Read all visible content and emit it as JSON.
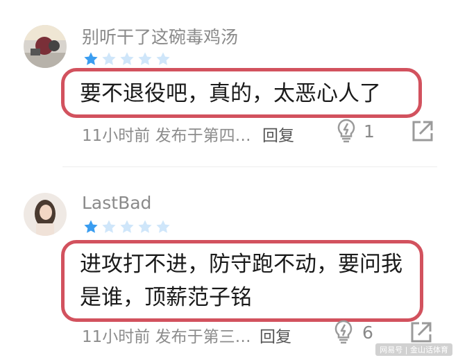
{
  "comments": [
    {
      "username": "别听干了这碗毒鸡汤",
      "rating": 1,
      "max_rating": 5,
      "text_lines": [
        "要不退役吧，真的，太恶心人了"
      ],
      "time": "11小时前",
      "published": "发布于第四…",
      "reply_label": "回复",
      "like_count": "1"
    },
    {
      "username": "LastBad",
      "rating": 1,
      "max_rating": 5,
      "text_lines": [
        "进攻打不进，防守跑不动，要问我",
        "是谁，顶薪范子铭"
      ],
      "time": "11小时前",
      "published": "发布于第三…",
      "reply_label": "回复",
      "like_count": "6"
    }
  ],
  "colors": {
    "star_active": "#3a9df0",
    "star_inactive": "#cfe6fa",
    "highlight_border": "#d2525e"
  },
  "watermark": "网易号 | 金山话体育",
  "icons": {
    "like": "lightbulb-icon",
    "share": "share-icon",
    "star": "star-icon"
  }
}
